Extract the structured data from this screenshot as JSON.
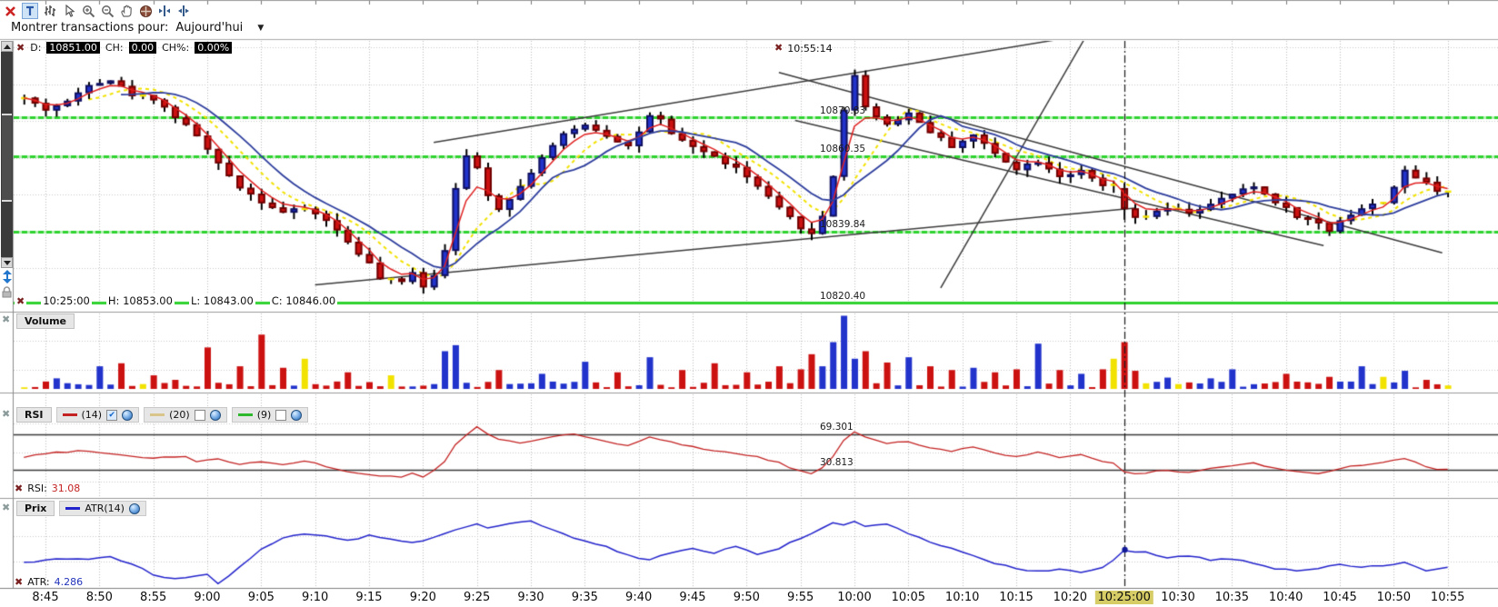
{
  "toolbar": {
    "icons": [
      {
        "name": "close",
        "glyph": "x",
        "active": false
      },
      {
        "name": "text-tool",
        "glyph": "T",
        "active": true
      },
      {
        "name": "bars-tool",
        "active": false
      },
      {
        "name": "cursor-tool",
        "active": false
      },
      {
        "name": "zoom-in",
        "active": false
      },
      {
        "name": "zoom-out",
        "active": false
      },
      {
        "name": "pan-tool",
        "active": false
      },
      {
        "name": "crosshair-tool",
        "active": false
      },
      {
        "name": "expand-bars",
        "active": false
      },
      {
        "name": "compress-bars",
        "active": false
      }
    ]
  },
  "filter_bar": {
    "label": "Montrer transactions pour:",
    "value": "Aujourd'hui"
  },
  "price_panel": {
    "quote": {
      "d_label": "D:",
      "d": "10851.00",
      "ch_label": "CH:",
      "ch": "0.00",
      "chp_label": "CH%:",
      "chp": "0.00%"
    },
    "cursor_time": "10:55:14",
    "levels": [
      {
        "label": "10870.83",
        "value": 10870.83
      },
      {
        "label": "10860.35",
        "value": 10860.35
      },
      {
        "label": "10839.84",
        "value": 10839.84
      },
      {
        "label": "10820.40",
        "value": 10820.4
      }
    ],
    "status": {
      "time": "10:25:00",
      "h_label": "H:",
      "h": "10853.00",
      "l_label": "L:",
      "l": "10843.00",
      "c_label": "C:",
      "c": "10846.00"
    }
  },
  "volume_panel": {
    "title": "Volume"
  },
  "rsi_panel": {
    "title": "RSI",
    "series": [
      {
        "label": "(14)",
        "color": "#c42222",
        "checked": true
      },
      {
        "label": "(20)",
        "color": "#d9c489",
        "checked": false
      },
      {
        "label": "(9)",
        "color": "#2db82d",
        "checked": false
      }
    ],
    "upper_level": {
      "label": "69.301",
      "value": 69.301
    },
    "lower_level": {
      "label": "30.813",
      "value": 30.813
    },
    "readout_label": "RSI:",
    "readout": "31.08"
  },
  "atr_panel": {
    "title": "Prix",
    "series_label": "ATR(14)",
    "readout_label": "ATR:",
    "readout": "4.286"
  },
  "x_axis": {
    "labels": [
      "8:45",
      "8:50",
      "8:55",
      "9:00",
      "9:05",
      "9:10",
      "9:15",
      "9:20",
      "9:25",
      "9:30",
      "9:35",
      "9:40",
      "9:45",
      "9:50",
      "9:55",
      "10:00",
      "10:05",
      "10:10",
      "10:15",
      "10:20",
      "10:25:00",
      "10:30",
      "10:35",
      "10:40",
      "10:45",
      "10:50",
      "10:55"
    ],
    "highlighted": "10:25:00"
  },
  "colors": {
    "candle_up": "#2233cc",
    "candle_down": "#cc1111",
    "doji": "#f2e200",
    "ma_fast": "#e02020",
    "ma_slow": "#2f3f9e",
    "ma_dashed": "#f2e200",
    "level_green": "#2fd32f",
    "trendline": "#3c3c3c",
    "rsi_line": "#c42222",
    "atr_line": "#2222cc"
  },
  "chart_data": {
    "type": "candlestick",
    "interval": "1min",
    "time_start": "8:43",
    "time_end": "10:55",
    "price_ylim": [
      10820,
      10892
    ],
    "price_levels": [
      10870.83,
      10860.35,
      10839.84,
      10820.4
    ],
    "selected_time_min": 102,
    "ohlc_selected": {
      "time": "10:25:00",
      "open": 10851.5,
      "high": 10853.0,
      "low": 10843.0,
      "close": 10846.0
    },
    "last_price": 10851.0,
    "price_anchors": [
      [
        0,
        10876
      ],
      [
        2,
        10873
      ],
      [
        4,
        10875
      ],
      [
        6,
        10880
      ],
      [
        8,
        10881
      ],
      [
        10,
        10877
      ],
      [
        12,
        10876
      ],
      [
        14,
        10871
      ],
      [
        16,
        10866
      ],
      [
        18,
        10858
      ],
      [
        20,
        10852
      ],
      [
        22,
        10848
      ],
      [
        24,
        10845
      ],
      [
        26,
        10846
      ],
      [
        28,
        10843
      ],
      [
        30,
        10837
      ],
      [
        32,
        10831
      ],
      [
        33,
        10827
      ],
      [
        35,
        10826
      ],
      [
        36,
        10829
      ],
      [
        37,
        10825
      ],
      [
        38,
        10828
      ],
      [
        39,
        10835
      ],
      [
        40,
        10852
      ],
      [
        41,
        10860
      ],
      [
        42,
        10857
      ],
      [
        43,
        10850
      ],
      [
        44,
        10846
      ],
      [
        46,
        10852
      ],
      [
        48,
        10860
      ],
      [
        50,
        10866
      ],
      [
        52,
        10869
      ],
      [
        54,
        10866
      ],
      [
        56,
        10863
      ],
      [
        57,
        10867
      ],
      [
        58,
        10871
      ],
      [
        59,
        10870
      ],
      [
        60,
        10866
      ],
      [
        62,
        10863
      ],
      [
        64,
        10860
      ],
      [
        66,
        10857
      ],
      [
        68,
        10852
      ],
      [
        70,
        10846
      ],
      [
        72,
        10841
      ],
      [
        73,
        10839
      ],
      [
        74,
        10844
      ],
      [
        75,
        10855
      ],
      [
        76,
        10873
      ],
      [
        77,
        10882
      ],
      [
        78,
        10874
      ],
      [
        79,
        10871
      ],
      [
        80,
        10869
      ],
      [
        82,
        10872
      ],
      [
        84,
        10867
      ],
      [
        86,
        10863
      ],
      [
        88,
        10866
      ],
      [
        90,
        10861
      ],
      [
        92,
        10857
      ],
      [
        94,
        10859
      ],
      [
        96,
        10855
      ],
      [
        98,
        10856
      ],
      [
        100,
        10852
      ],
      [
        101,
        10852.5
      ],
      [
        102,
        10846
      ],
      [
        103,
        10843.5
      ],
      [
        104,
        10844
      ],
      [
        106,
        10846
      ],
      [
        108,
        10845
      ],
      [
        110,
        10847
      ],
      [
        112,
        10850
      ],
      [
        114,
        10852
      ],
      [
        116,
        10848
      ],
      [
        118,
        10844
      ],
      [
        120,
        10842
      ],
      [
        121,
        10840
      ],
      [
        122,
        10843
      ],
      [
        124,
        10846
      ],
      [
        126,
        10848
      ],
      [
        128,
        10856
      ],
      [
        130,
        10853
      ],
      [
        131,
        10851
      ],
      [
        132,
        10851
      ]
    ],
    "trendlines": [
      [
        [
          38,
          10864
        ],
        [
          99,
          10893.5
        ]
      ],
      [
        [
          27,
          10825.3
        ],
        [
          103,
          10846.2
        ]
      ],
      [
        [
          85,
          10824.5
        ],
        [
          98.5,
          10893
        ]
      ],
      [
        [
          70,
          10883
        ],
        [
          131.5,
          10834
        ]
      ],
      [
        [
          71.5,
          10870
        ],
        [
          120.5,
          10836
        ]
      ]
    ],
    "volume_spikes": [
      [
        3,
        14
      ],
      [
        7,
        30
      ],
      [
        9,
        34
      ],
      [
        12,
        18
      ],
      [
        14,
        12
      ],
      [
        17,
        55
      ],
      [
        20,
        30
      ],
      [
        22,
        72
      ],
      [
        24,
        28
      ],
      [
        26,
        40
      ],
      [
        30,
        22
      ],
      [
        34,
        18
      ],
      [
        39,
        50
      ],
      [
        40,
        58
      ],
      [
        44,
        25
      ],
      [
        48,
        20
      ],
      [
        52,
        36
      ],
      [
        55,
        22
      ],
      [
        58,
        42
      ],
      [
        61,
        25
      ],
      [
        64,
        34
      ],
      [
        67,
        22
      ],
      [
        70,
        30
      ],
      [
        72,
        26
      ],
      [
        73,
        46
      ],
      [
        74,
        30
      ],
      [
        75,
        62
      ],
      [
        76,
        97
      ],
      [
        77,
        40
      ],
      [
        78,
        50
      ],
      [
        80,
        35
      ],
      [
        82,
        42
      ],
      [
        84,
        30
      ],
      [
        86,
        25
      ],
      [
        88,
        28
      ],
      [
        90,
        22
      ],
      [
        92,
        26
      ],
      [
        94,
        60
      ],
      [
        96,
        25
      ],
      [
        98,
        20
      ],
      [
        100,
        26
      ],
      [
        101,
        40
      ],
      [
        102,
        62
      ],
      [
        103,
        24
      ],
      [
        106,
        15
      ],
      [
        110,
        14
      ],
      [
        112,
        26
      ],
      [
        117,
        20
      ],
      [
        121,
        16
      ],
      [
        124,
        30
      ],
      [
        126,
        16
      ],
      [
        128,
        24
      ],
      [
        130,
        12
      ]
    ],
    "rsi_levels": [
      69.301,
      30.813
    ],
    "rsi_last": 31.08,
    "rsi_anchors": [
      [
        0,
        45
      ],
      [
        3,
        50
      ],
      [
        6,
        52
      ],
      [
        9,
        47
      ],
      [
        12,
        44
      ],
      [
        15,
        46
      ],
      [
        16,
        40
      ],
      [
        18,
        43
      ],
      [
        20,
        37
      ],
      [
        22,
        40
      ],
      [
        24,
        36
      ],
      [
        26,
        41
      ],
      [
        28,
        35
      ],
      [
        30,
        29
      ],
      [
        33,
        25
      ],
      [
        35,
        23.5
      ],
      [
        36,
        27
      ],
      [
        37,
        24
      ],
      [
        38,
        30
      ],
      [
        39,
        40
      ],
      [
        40,
        58
      ],
      [
        41,
        68
      ],
      [
        42,
        77
      ],
      [
        43,
        70
      ],
      [
        44,
        64
      ],
      [
        46,
        60
      ],
      [
        48,
        65
      ],
      [
        50,
        68
      ],
      [
        51,
        69.5
      ],
      [
        52,
        67
      ],
      [
        54,
        61
      ],
      [
        56,
        57
      ],
      [
        57,
        62
      ],
      [
        58,
        66
      ],
      [
        60,
        61
      ],
      [
        62,
        56
      ],
      [
        64,
        52
      ],
      [
        66,
        49
      ],
      [
        68,
        45
      ],
      [
        70,
        39
      ],
      [
        71,
        34
      ],
      [
        72,
        30
      ],
      [
        73,
        27
      ],
      [
        74,
        33
      ],
      [
        75,
        46
      ],
      [
        76,
        62
      ],
      [
        77,
        71.5
      ],
      [
        78,
        67
      ],
      [
        79,
        63
      ],
      [
        80,
        59
      ],
      [
        82,
        62
      ],
      [
        84,
        55
      ],
      [
        86,
        51
      ],
      [
        88,
        56
      ],
      [
        90,
        50
      ],
      [
        92,
        45
      ],
      [
        94,
        50
      ],
      [
        96,
        44
      ],
      [
        98,
        47
      ],
      [
        100,
        41
      ],
      [
        101,
        38
      ],
      [
        102,
        29
      ],
      [
        103,
        26.5
      ],
      [
        104,
        28
      ],
      [
        106,
        31
      ],
      [
        108,
        28.5
      ],
      [
        110,
        33
      ],
      [
        112,
        36
      ],
      [
        114,
        38.5
      ],
      [
        116,
        33
      ],
      [
        118,
        29
      ],
      [
        120,
        27
      ],
      [
        122,
        33
      ],
      [
        124,
        36
      ],
      [
        126,
        39
      ],
      [
        128,
        43
      ],
      [
        129,
        40
      ],
      [
        130,
        34
      ],
      [
        131,
        32
      ],
      [
        132,
        31.08
      ]
    ],
    "atr_last": 4.286,
    "atr_anchors": [
      [
        0,
        4.6
      ],
      [
        3,
        4.9
      ],
      [
        6,
        4.8
      ],
      [
        8,
        5.0
      ],
      [
        10,
        4.5
      ],
      [
        12,
        3.8
      ],
      [
        14,
        3.5
      ],
      [
        16,
        3.7
      ],
      [
        17,
        3.8
      ],
      [
        18,
        3.2
      ],
      [
        19,
        3.7
      ],
      [
        20,
        4.3
      ],
      [
        22,
        5.6
      ],
      [
        24,
        6.3
      ],
      [
        26,
        6.6
      ],
      [
        28,
        6.4
      ],
      [
        30,
        6.1
      ],
      [
        32,
        6.5
      ],
      [
        34,
        6.2
      ],
      [
        36,
        6.0
      ],
      [
        38,
        6.3
      ],
      [
        40,
        6.9
      ],
      [
        42,
        7.3
      ],
      [
        43,
        7.0
      ],
      [
        44,
        7.1
      ],
      [
        46,
        7.4
      ],
      [
        47,
        7.5
      ],
      [
        48,
        7.2
      ],
      [
        50,
        6.6
      ],
      [
        52,
        6.1
      ],
      [
        54,
        5.7
      ],
      [
        56,
        5.1
      ],
      [
        58,
        4.8
      ],
      [
        60,
        5.3
      ],
      [
        62,
        5.6
      ],
      [
        64,
        5.3
      ],
      [
        66,
        5.7
      ],
      [
        68,
        5.2
      ],
      [
        70,
        5.6
      ],
      [
        72,
        6.3
      ],
      [
        74,
        7.0
      ],
      [
        75,
        7.3
      ],
      [
        76,
        7.2
      ],
      [
        77,
        7.4
      ],
      [
        78,
        7.1
      ],
      [
        80,
        7.3
      ],
      [
        82,
        6.6
      ],
      [
        84,
        6.0
      ],
      [
        86,
        5.6
      ],
      [
        88,
        5.1
      ],
      [
        90,
        4.6
      ],
      [
        92,
        4.2
      ],
      [
        94,
        4.0
      ],
      [
        96,
        4.15
      ],
      [
        98,
        3.95
      ],
      [
        100,
        4.3
      ],
      [
        101,
        4.8
      ],
      [
        102,
        5.5
      ],
      [
        103,
        5.4
      ],
      [
        104,
        5.35
      ],
      [
        106,
        5.0
      ],
      [
        108,
        5.1
      ],
      [
        110,
        4.8
      ],
      [
        112,
        4.9
      ],
      [
        114,
        4.6
      ],
      [
        116,
        4.2
      ],
      [
        118,
        4.05
      ],
      [
        120,
        4.25
      ],
      [
        122,
        4.5
      ],
      [
        124,
        4.3
      ],
      [
        126,
        4.4
      ],
      [
        128,
        4.6
      ],
      [
        129,
        4.4
      ],
      [
        130,
        4.1
      ],
      [
        131,
        4.2
      ],
      [
        132,
        4.286
      ]
    ]
  }
}
